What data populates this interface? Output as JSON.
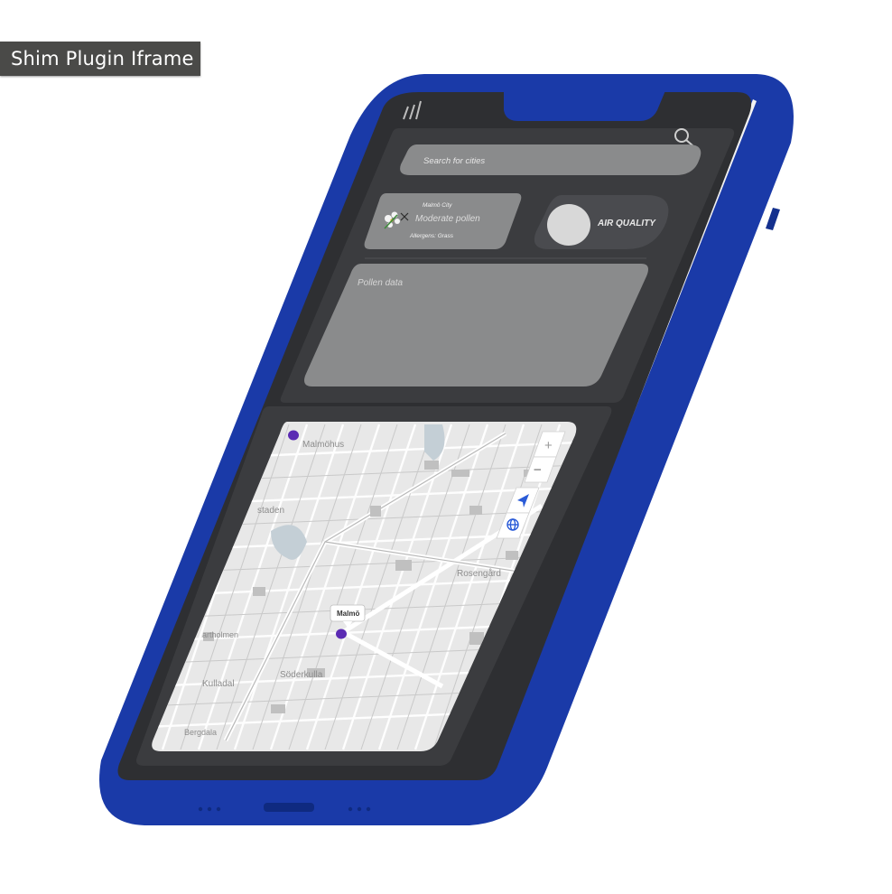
{
  "shim": {
    "label": "Shim Plugin Iframe"
  },
  "app": {
    "search": {
      "placeholder": "Search for cities"
    },
    "pollen_card": {
      "city": "Malmö City",
      "level": "Moderate pollen",
      "allergens": "Allergens: Grass"
    },
    "air_quality": {
      "label": "AIR QUALITY",
      "toggle_on": false
    },
    "pollen_data": {
      "title": "Pollen data"
    },
    "map": {
      "marker_label": "Malmö",
      "place_names": [
        "Malmöhus",
        "staden",
        "Rosengård",
        "artholmen",
        "Söderkulla",
        "Kulladal",
        "Bergdala"
      ],
      "controls": {
        "zoom_in": "+",
        "zoom_out": "−"
      }
    }
  },
  "colors": {
    "phone_body": "#1a3aa8",
    "screen": "#2e2f32",
    "panel": "#3b3c3f",
    "field": "#8a8b8c",
    "map_bg": "#e8e8e8",
    "marker": "#5b2bb3"
  }
}
